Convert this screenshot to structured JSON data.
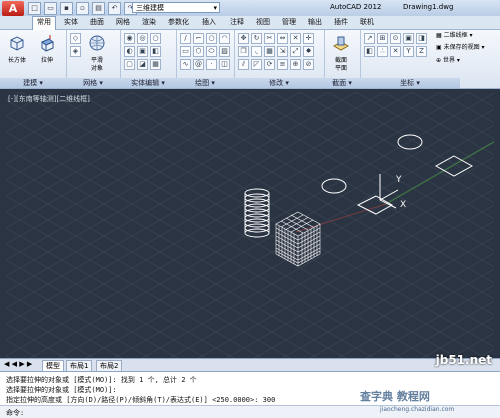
{
  "titlebar": {
    "app_letter": "A",
    "workspace": "三维建模",
    "app_name": "AutoCAD 2012",
    "document": "Drawing1.dwg"
  },
  "menu_tabs": [
    "常用",
    "实体",
    "曲面",
    "网格",
    "渲染",
    "参数化",
    "插入",
    "注释",
    "视图",
    "管理",
    "输出",
    "插件",
    "联机"
  ],
  "ribbon": {
    "panels": {
      "modeling": "建模",
      "mesh": "网格",
      "solid_edit": "实体编辑",
      "draw": "绘图",
      "modify": "修改",
      "section": "截面",
      "coordinates": "坐标"
    },
    "tools": {
      "box": "长方体",
      "extrude": "拉伸",
      "smooth_object_line1": "平滑",
      "smooth_object_line2": "对象",
      "section_plane_line1": "截面",
      "section_plane_line2": "平面",
      "wireframe": "二维线框",
      "unsaved_view": "未保存的视图",
      "world": "世界"
    }
  },
  "viewport": {
    "label": "[-][东南等轴测][二维线框]",
    "axis_x": "X",
    "axis_y": "Y"
  },
  "layout_tabs": {
    "nav": "◀ ◀ ▶ ▶",
    "tabs": [
      "模型",
      "布局1",
      "布局2"
    ]
  },
  "command": {
    "lines": [
      "选择要拉伸的对象或 [模式(MO)]: 找到 1 个, 总计 2 个",
      "选择要拉伸的对象或 [模式(MO)]:",
      "指定拉伸的高度或 [方向(D)/路径(P)/倾斜角(T)/表达式(E)] <250.0000>: 300"
    ],
    "prompt": "命令:"
  },
  "watermarks": {
    "site": "jb51.net",
    "brand": "查字典 教程网",
    "url": "jiaocheng.chazidian.com"
  }
}
